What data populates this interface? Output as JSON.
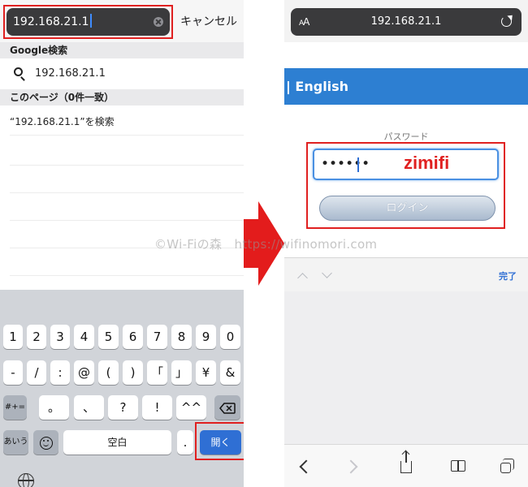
{
  "left_screen": {
    "search_value": "192.168.21.1",
    "cancel_label": "キャンセル",
    "google_section": "Google検索",
    "google_suggestion": "192.168.21.1",
    "this_page_section": "このページ（0件一致）",
    "find_on_page": "“192.168.21.1”を検索",
    "keyboard": {
      "row1": [
        "1",
        "2",
        "3",
        "4",
        "5",
        "6",
        "7",
        "8",
        "9",
        "0"
      ],
      "row2": [
        "-",
        "/",
        ":",
        "@",
        "(",
        ")",
        "「",
        "」",
        "¥",
        "&"
      ],
      "row3": [
        "#+=",
        "。",
        "、",
        "?",
        "!",
        "^^"
      ],
      "row4": [
        "あいう",
        "空白",
        ".",
        "開く"
      ]
    }
  },
  "right_screen": {
    "font_size_label_small": "A",
    "font_size_label_large": "A",
    "url": "192.168.21.1",
    "language": "| English",
    "password_label": "パスワード",
    "password_dots": "••••••",
    "password_annotation": "zimifi",
    "login_label": "ログイン",
    "done_label": "完了"
  },
  "watermark": "©Wi-Fiの森　https://wifinomori.com",
  "colors": {
    "highlight": "#e02020",
    "accent_blue": "#2d7fd2",
    "open_key": "#2f6fd4"
  }
}
